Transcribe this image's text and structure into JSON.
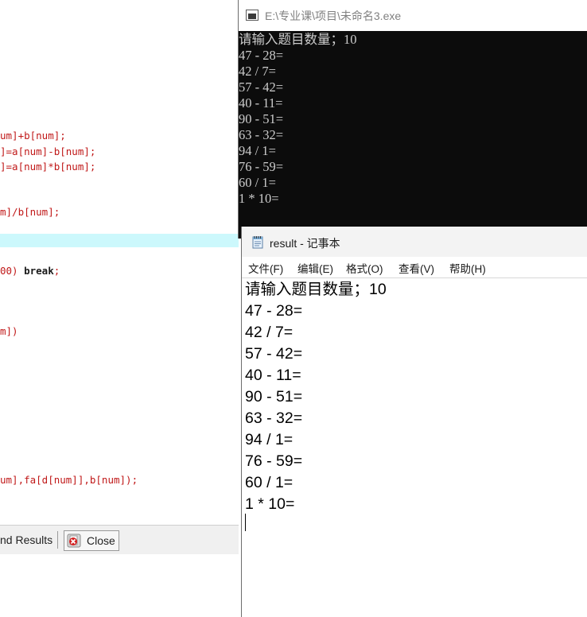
{
  "editor": {
    "lines": [
      {
        "pre": "um]+b[num];",
        "kw": "",
        "post": ""
      },
      {
        "pre": "]=a[num]-b[num];",
        "kw": "",
        "post": ""
      },
      {
        "pre": "]=a[num]*b[num];",
        "kw": "",
        "post": ""
      },
      {
        "pre": "m]/b[num];",
        "kw": "",
        "post": ""
      },
      {
        "pre": "00) ",
        "kw": "break",
        "post": ";"
      },
      {
        "pre": "m])",
        "kw": "",
        "post": ""
      },
      {
        "pre": "um],fa[d[num]],b[num]);",
        "kw": "",
        "post": ""
      }
    ],
    "bottom_tabs": {
      "find_results": "nd Results",
      "close": "Close"
    }
  },
  "console": {
    "title": "E:\\专业课\\项目\\未命名3.exe",
    "lines": [
      "请输入题目数量；10",
      "47 - 28=",
      "42 / 7=",
      "57 - 42=",
      "40 - 11=",
      "90 - 51=",
      "63 - 32=",
      "94 / 1=",
      "76 - 59=",
      "60 / 1=",
      "1 * 10="
    ]
  },
  "notepad": {
    "title": "result - 记事本",
    "menu": [
      "文件(F)",
      "编辑(E)",
      "格式(O)",
      "查看(V)",
      "帮助(H)"
    ],
    "lines": [
      "请输入题目数量；10",
      "47 - 28=",
      "42 / 7=",
      "57 - 42=",
      "40 - 11=",
      "90 - 51=",
      "63 - 32=",
      "94 / 1=",
      "76 - 59=",
      "60 / 1=",
      "1 * 10="
    ]
  },
  "colors": {
    "code_text": "#c01818",
    "current_line_highlight": "#ccf8fc",
    "console_background": "#0c0c0c",
    "console_text": "#cccccc"
  },
  "icons": {
    "console": "console-app-icon",
    "notepad": "notepad-icon",
    "close": "close-x-icon"
  }
}
